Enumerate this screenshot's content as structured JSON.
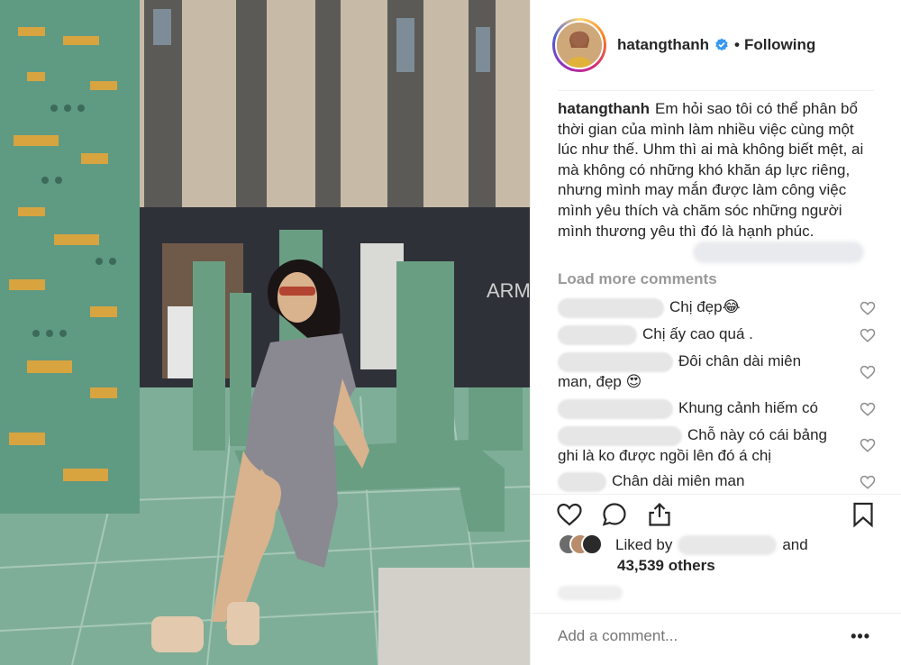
{
  "post": {
    "username": "hatangthanh",
    "separator": "•",
    "follow_status": "Following",
    "caption_text": "Em hỏi sao tôi có thể phân bổ thời gian của mình làm nhiều việc cùng một lúc như thế. Uhm thì ai mà không biết mệt, ai mà không có những khó khăn áp lực riêng, nhưng mình may mắn được làm công việc mình yêu thích và chăm sóc những người mình thương yêu thì đó là hạnh phúc.",
    "load_more": "Load more comments"
  },
  "comments": [
    {
      "text": "Chị đẹp😂"
    },
    {
      "text": "Chị ấy cao quá ."
    },
    {
      "text": "Đôi chân dài miên man, đẹp 😍"
    },
    {
      "text": "Khung cảnh hiếm có"
    },
    {
      "text": "Chỗ này có cái bảng ghi là ko được ngồi lên đó á chị"
    },
    {
      "text": "Chân dài miên man"
    }
  ],
  "likes": {
    "prefix": "Liked by",
    "conj": "and",
    "others": "43,539 others"
  },
  "add_comment": {
    "placeholder": "Add a comment..."
  },
  "more_label": "•••",
  "colors": {
    "verified": "#3897f0",
    "muted": "#999999",
    "divider": "#efefef",
    "bench": "#6a9e83"
  },
  "icons": [
    "verified-badge-icon",
    "heart-icon",
    "comment-icon",
    "share-icon",
    "bookmark-icon",
    "more-options-icon"
  ]
}
